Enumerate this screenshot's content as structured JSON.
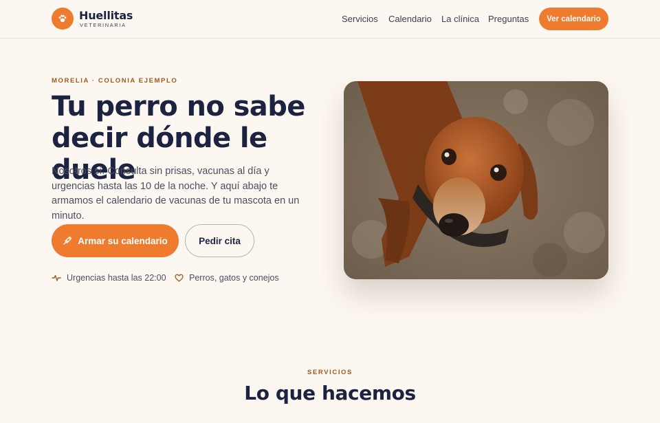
{
  "brand": {
    "name": "Huellitas",
    "subtitle": "VETERINARIA",
    "logo_icon": "paw-icon",
    "accent_color": "#ee7b2e"
  },
  "nav": {
    "links": [
      "Servicios",
      "Calendario",
      "La clínica",
      "Preguntas"
    ],
    "cta_label": "Ver calendario"
  },
  "hero": {
    "eyebrow": "MORELIA · COLONIA EJEMPLO",
    "title_line1": "Tu perro no sabe",
    "title_line2": "decir dónde le duele",
    "description": "Nosotros sí. Consulta sin prisas, vacunas al día y urgencias hasta las 10 de la noche. Y aquí abajo te armamos el calendario de vacunas de tu mascota en un minuto.",
    "primary_button": "Armar su calendario",
    "primary_button_icon": "syringe-icon",
    "secondary_button": "Pedir cita",
    "features": [
      {
        "icon": "pulse-icon",
        "text": "Urgencias hasta las 22:00"
      },
      {
        "icon": "heart-icon",
        "text": "Perros, gatos y conejos"
      }
    ]
  },
  "photo": {
    "subject": "dachshund-photo"
  },
  "services": {
    "eyebrow": "SERVICIOS",
    "title": "Lo que hacemos"
  }
}
